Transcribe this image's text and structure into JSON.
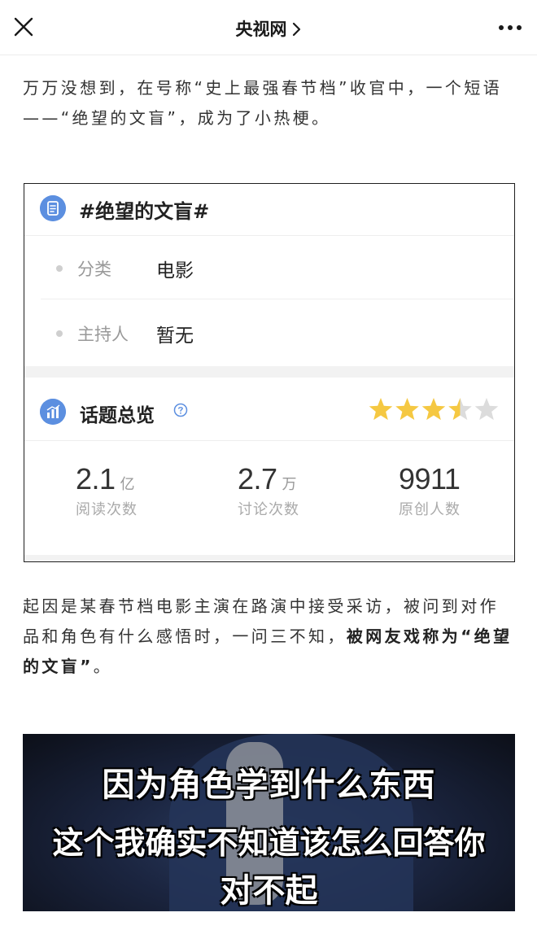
{
  "nav": {
    "title": "央视网",
    "close_icon": "close-icon",
    "more_icon": "more-icon"
  },
  "article": {
    "para1": "万万没想到，在号称“史上最强春节档”收官中，一个短语——“绝望的文盲”，成为了小热梗。",
    "para2_normal": "起因是某春节档电影主演在路演中接受采访，被问到对作品和角色有什么感悟时，一问三不知，",
    "para2_bold": "被网友戏称为“绝望的文盲”",
    "para2_end": "。"
  },
  "topic_card": {
    "title": "#绝望的文盲#",
    "meta": [
      {
        "key": "分类",
        "value": "电影"
      },
      {
        "key": "主持人",
        "value": "暂无"
      }
    ],
    "overview_title": "话题总览",
    "rating": 3.5,
    "rating_max": 5,
    "colors": {
      "accent": "#5c8fe0",
      "star": "#f5c842",
      "star_empty": "#dcdcdc"
    },
    "stats": [
      {
        "value": "2.1",
        "unit": "亿",
        "label": "阅读次数"
      },
      {
        "value": "2.7",
        "unit": "万",
        "label": "讨论次数"
      },
      {
        "value": "9911",
        "unit": "",
        "label": "原创人数"
      }
    ]
  },
  "video": {
    "subtitles": [
      "因为角色学到什么东西",
      "这个我确实不知道该怎么回答你",
      "对不起"
    ]
  }
}
